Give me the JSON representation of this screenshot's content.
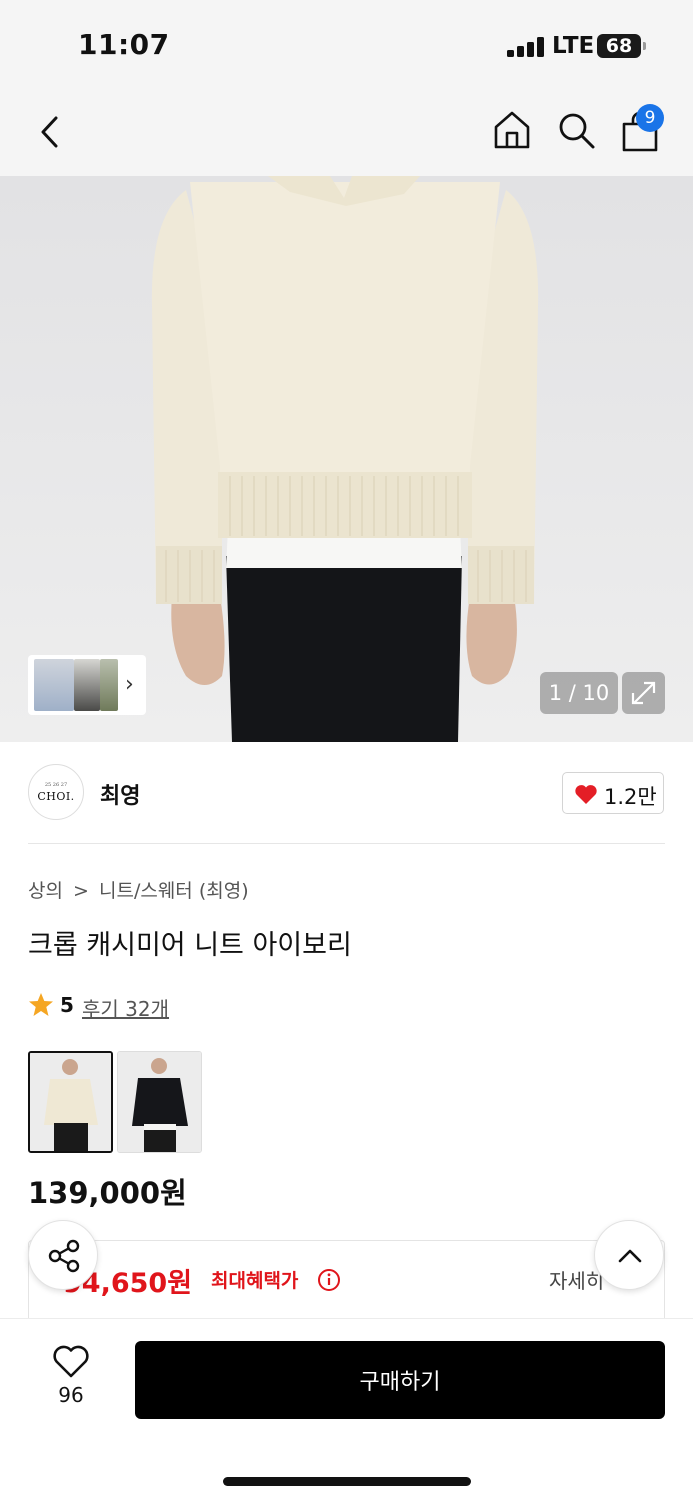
{
  "status_bar": {
    "time": "11:07",
    "network": "LTE",
    "battery": "68"
  },
  "nav": {
    "back_icon": "chevron-left",
    "home_icon": "home",
    "search_icon": "search",
    "cart_icon": "shopping-bag",
    "cart_count": "9"
  },
  "gallery": {
    "counter": "1 / 10",
    "thumbnail_next_icon": "chevron-right",
    "expand_icon": "expand-diagonal"
  },
  "brand": {
    "logo_small": "25 26 27",
    "logo_text": "CHOI.",
    "name": "최영",
    "like_count": "1.2만"
  },
  "product": {
    "breadcrumb": [
      "상의",
      "니트/스웨터 (최영)"
    ],
    "breadcrumb_sep": ">",
    "title": "크롭 캐시미어 니트 아이보리",
    "rating": "5",
    "reviews_label": "후기 32개",
    "color_options": [
      "ivory",
      "black"
    ],
    "price": "139,000원"
  },
  "benefit": {
    "max_benefit_price": "94,650원",
    "label": "최대혜택가",
    "detail_label": "자세히"
  },
  "bottom_bar": {
    "wish_count": "96",
    "buy_label": "구매하기"
  },
  "colors": {
    "accent_blue": "#1a74e8",
    "sale_red": "#e0151b",
    "star": "#f5a623",
    "heart": "#e41e26"
  }
}
